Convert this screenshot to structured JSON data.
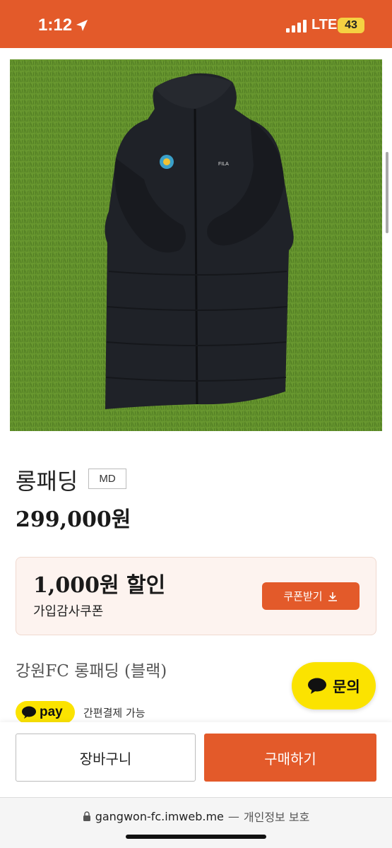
{
  "status_bar": {
    "time": "1:12",
    "network": "LTE",
    "battery": "43"
  },
  "product": {
    "image_icon": "black-long-padded-jacket-photo",
    "title": "롱패딩",
    "badge": "MD",
    "price": "299,000원",
    "subtitle": "강원FC 롱패딩 (블랙)"
  },
  "coupon": {
    "amount": "1,000원 할인",
    "description": "가입감사쿠폰",
    "button_label": "쿠폰받기"
  },
  "pay": {
    "badge_label": "pay",
    "description": "간편결제 가능"
  },
  "inquiry": {
    "label": "문의"
  },
  "actions": {
    "cart_label": "장바구니",
    "buy_label": "구매하기"
  },
  "browser": {
    "domain": "gangwon-fc.imweb.me",
    "separator": "—",
    "privacy": "개인정보 보호"
  },
  "colors": {
    "accent": "#e35a2a",
    "kakao_yellow": "#fbe300",
    "coupon_bg": "#fdf3ef"
  }
}
